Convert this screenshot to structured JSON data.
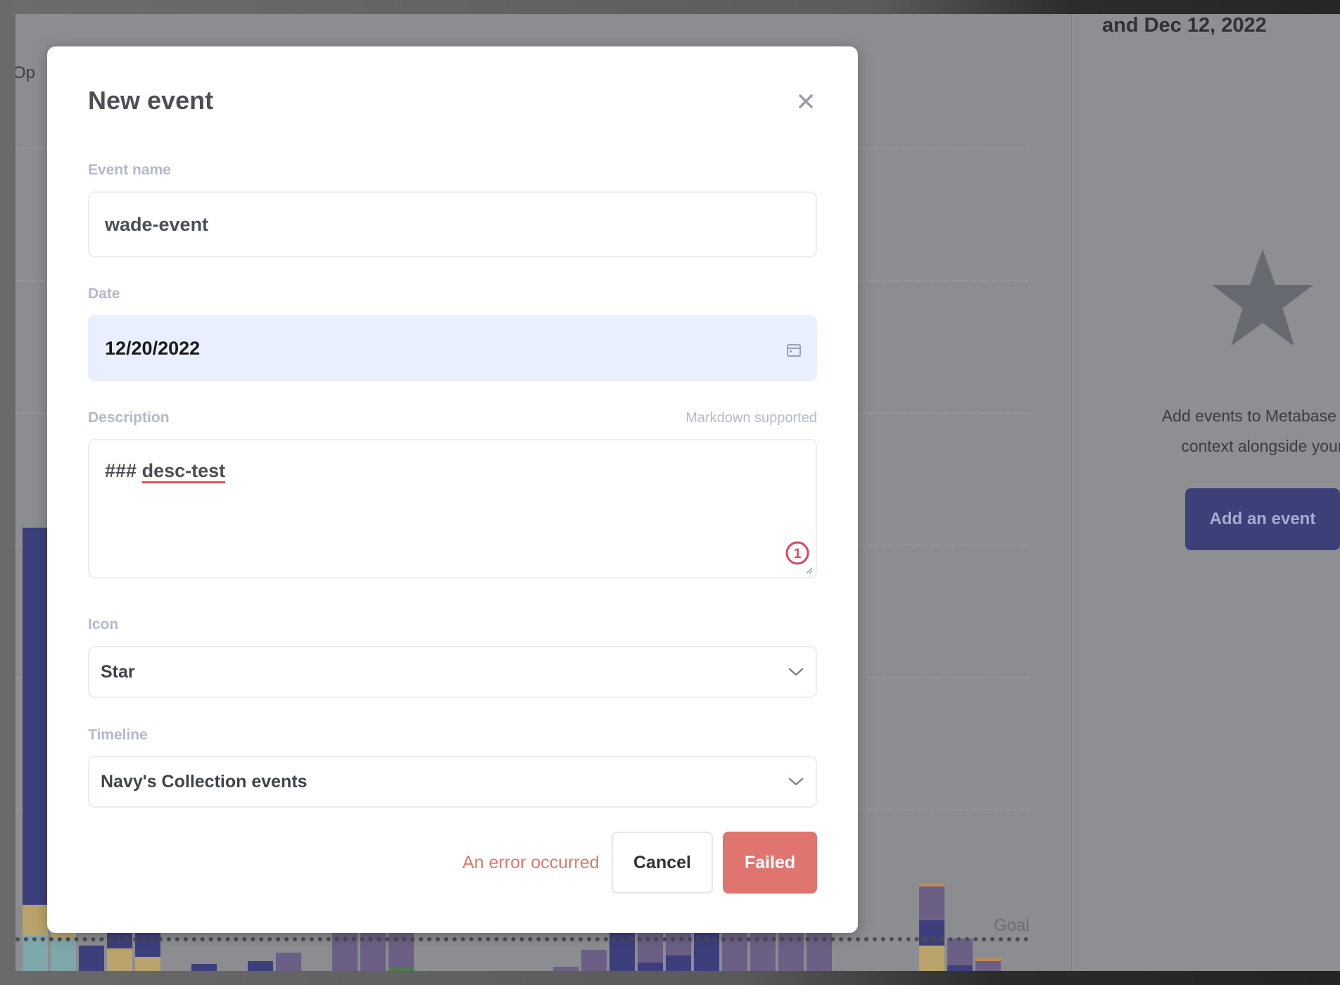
{
  "background": {
    "sidebar": {
      "title": "and Dec 12, 2022",
      "empty_icon": "star-icon",
      "empty_text_line1": "Add events to Metabase to sh",
      "empty_text_line2": "context alongside your d",
      "add_button_label": "Add an event"
    },
    "chart": {
      "partial_label": "Op",
      "goal_label": "Goal"
    }
  },
  "modal": {
    "title": "New event",
    "close_icon": "close-icon",
    "fields": {
      "event_name": {
        "label": "Event name",
        "value": "wade-event"
      },
      "date": {
        "label": "Date",
        "value": "12/20/2022",
        "icon": "calendar-icon"
      },
      "description": {
        "label": "Description",
        "hint": "Markdown supported",
        "value_prefix": "###",
        "value_text": "desc-test",
        "badge": "1"
      },
      "icon": {
        "label": "Icon",
        "value": "Star"
      },
      "timeline": {
        "label": "Timeline",
        "value": "Navy's Collection events"
      }
    },
    "footer": {
      "error_text": "An error occurred",
      "cancel_label": "Cancel",
      "submit_label": "Failed"
    }
  },
  "colors": {
    "primary_navy": "#3c3f78",
    "error": "#e0746f",
    "date_bg": "#e9effc"
  }
}
